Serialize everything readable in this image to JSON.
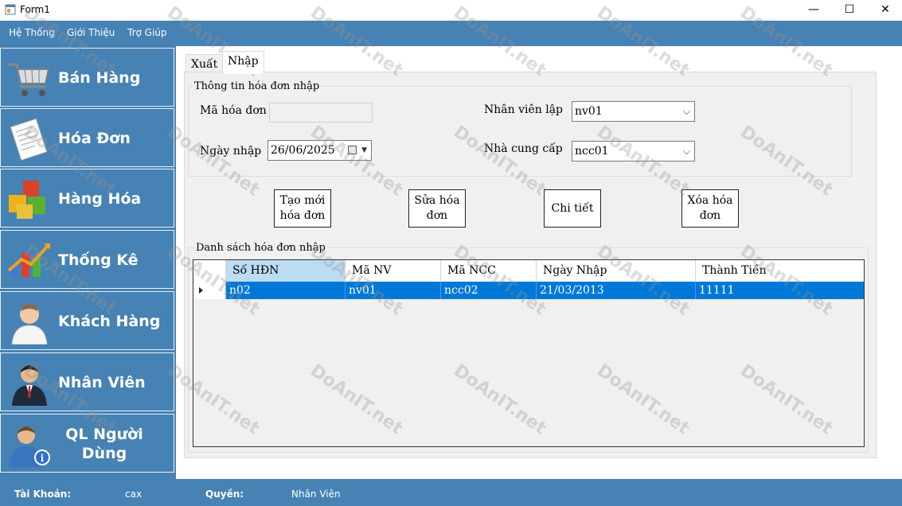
{
  "window": {
    "title": "Form1",
    "minimize": "—",
    "maximize": "☐",
    "close": "✕"
  },
  "menu": [
    "Hệ Thống",
    "Giới Thiệu",
    "Trợ Giúp"
  ],
  "sidebar": [
    {
      "label": "Bán Hàng",
      "icon": "shopping-cart-icon"
    },
    {
      "label": "Hóa Đơn",
      "icon": "invoice-icon"
    },
    {
      "label": "Hàng Hóa",
      "icon": "goods-boxes-icon"
    },
    {
      "label": "Thống Kê",
      "icon": "statistics-chart-icon"
    },
    {
      "label": "Khách Hàng",
      "icon": "customer-icon"
    },
    {
      "label": "Nhân Viên",
      "icon": "employee-icon"
    },
    {
      "label": "QL Người Dùng",
      "icon": "user-management-icon"
    }
  ],
  "tabs": [
    "Xuất",
    "Nhập"
  ],
  "active_tab": "Nhập",
  "form": {
    "group_title": "Thông tin hóa đơn nhập",
    "invoice_id_label": "Mã hóa đơn",
    "invoice_id_value": "",
    "date_label": "Ngày nhập",
    "date_value": "26/06/2025",
    "employee_label": "Nhân viên lập",
    "employee_value": "nv01",
    "supplier_label": "Nhà cung cấp",
    "supplier_value": "ncc01"
  },
  "actions": {
    "create_line1": "Tạo mới",
    "create_line2": "hóa đơn",
    "edit_line1": "Sửa hóa",
    "edit_line2": "đơn",
    "detail": "Chi tiết",
    "delete_line1": "Xóa hóa",
    "delete_line2": "đơn"
  },
  "list": {
    "title": "Danh sách hóa đơn nhập",
    "columns": [
      "Số HĐN",
      "Mã NV",
      "Mã NCC",
      "Ngày Nhập",
      "Thành Tiền"
    ],
    "rows": [
      [
        "n02",
        "nv01",
        "ncc02",
        "21/03/2013",
        "11111"
      ]
    ]
  },
  "status": {
    "account_label": "Tài Khoản:",
    "account_value": "cax",
    "role_label": "Quyền:",
    "role_value": "Nhân Viên"
  },
  "watermark": "DoAnIT.net",
  "colors": {
    "accent": "#4682b4",
    "selection": "#0078d7"
  }
}
